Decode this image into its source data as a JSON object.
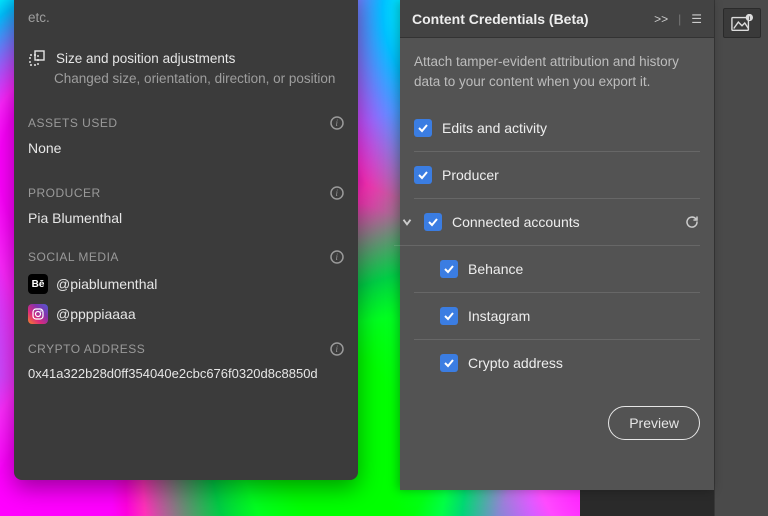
{
  "left": {
    "truncated_top": "etc.",
    "adjust_title": "Size and position adjustments",
    "adjust_sub": "Changed size, orientation, direction, or position",
    "assets_head": "ASSETS USED",
    "assets_val": "None",
    "producer_head": "PRODUCER",
    "producer_val": "Pia Blumenthal",
    "social_head": "SOCIAL MEDIA",
    "social": [
      {
        "platform": "behance",
        "handle": "@piablumenthal",
        "badge": "Bē"
      },
      {
        "platform": "instagram",
        "handle": "@ppppiaaaa",
        "badge": ""
      }
    ],
    "crypto_head": "CRYPTO ADDRESS",
    "crypto_val": "0x41a322b28d0ff354040e2cbc676f0320d8c8850d"
  },
  "right": {
    "title": "Content Credentials (Beta)",
    "desc": "Attach tamper-evident attribution and history data to your content when you export it.",
    "items": {
      "edits": "Edits and activity",
      "producer": "Producer",
      "connected": "Connected accounts",
      "behance": "Behance",
      "instagram": "Instagram",
      "crypto": "Crypto address"
    },
    "preview": "Preview"
  }
}
